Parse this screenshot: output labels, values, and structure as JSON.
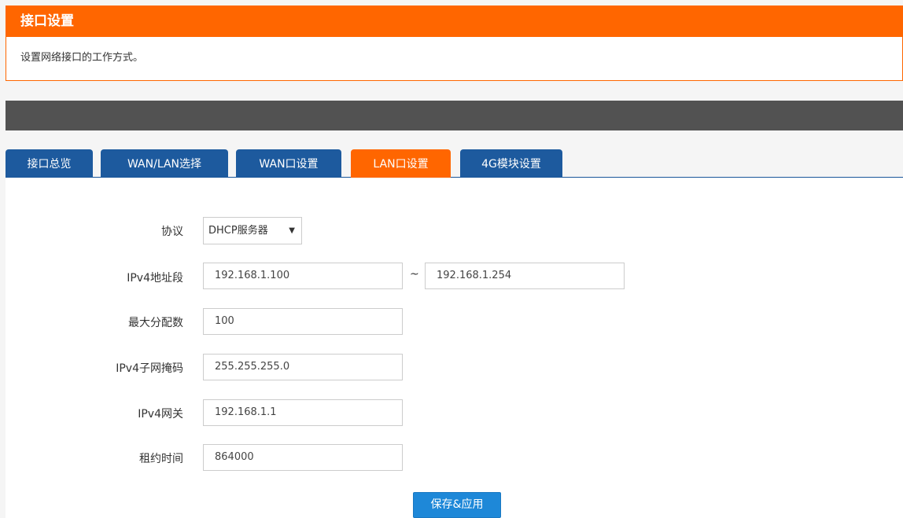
{
  "header": {
    "title": "接口设置",
    "description": "设置网络接口的工作方式。"
  },
  "tabs": [
    {
      "label": "接口总览",
      "active": false
    },
    {
      "label": "WAN/LAN选择",
      "active": false
    },
    {
      "label": "WAN口设置",
      "active": false
    },
    {
      "label": "LAN口设置",
      "active": true
    },
    {
      "label": "4G模块设置",
      "active": false
    }
  ],
  "form": {
    "protocol": {
      "label": "协议",
      "value": "DHCP服务器"
    },
    "ipv4_range": {
      "label": "IPv4地址段",
      "start": "192.168.1.100",
      "separator": "~",
      "end": "192.168.1.254"
    },
    "max_leases": {
      "label": "最大分配数",
      "value": "100"
    },
    "netmask": {
      "label": "IPv4子网掩码",
      "value": "255.255.255.0"
    },
    "gateway": {
      "label": "IPv4网关",
      "value": "192.168.1.1"
    },
    "lease_time": {
      "label": "租约时间",
      "value": "864000"
    },
    "save_label": "保存&应用"
  },
  "colors": {
    "accent": "#ff6600",
    "tab_blue": "#1d5a9e",
    "button_blue": "#1e88d8",
    "dark_bar": "#525252"
  }
}
